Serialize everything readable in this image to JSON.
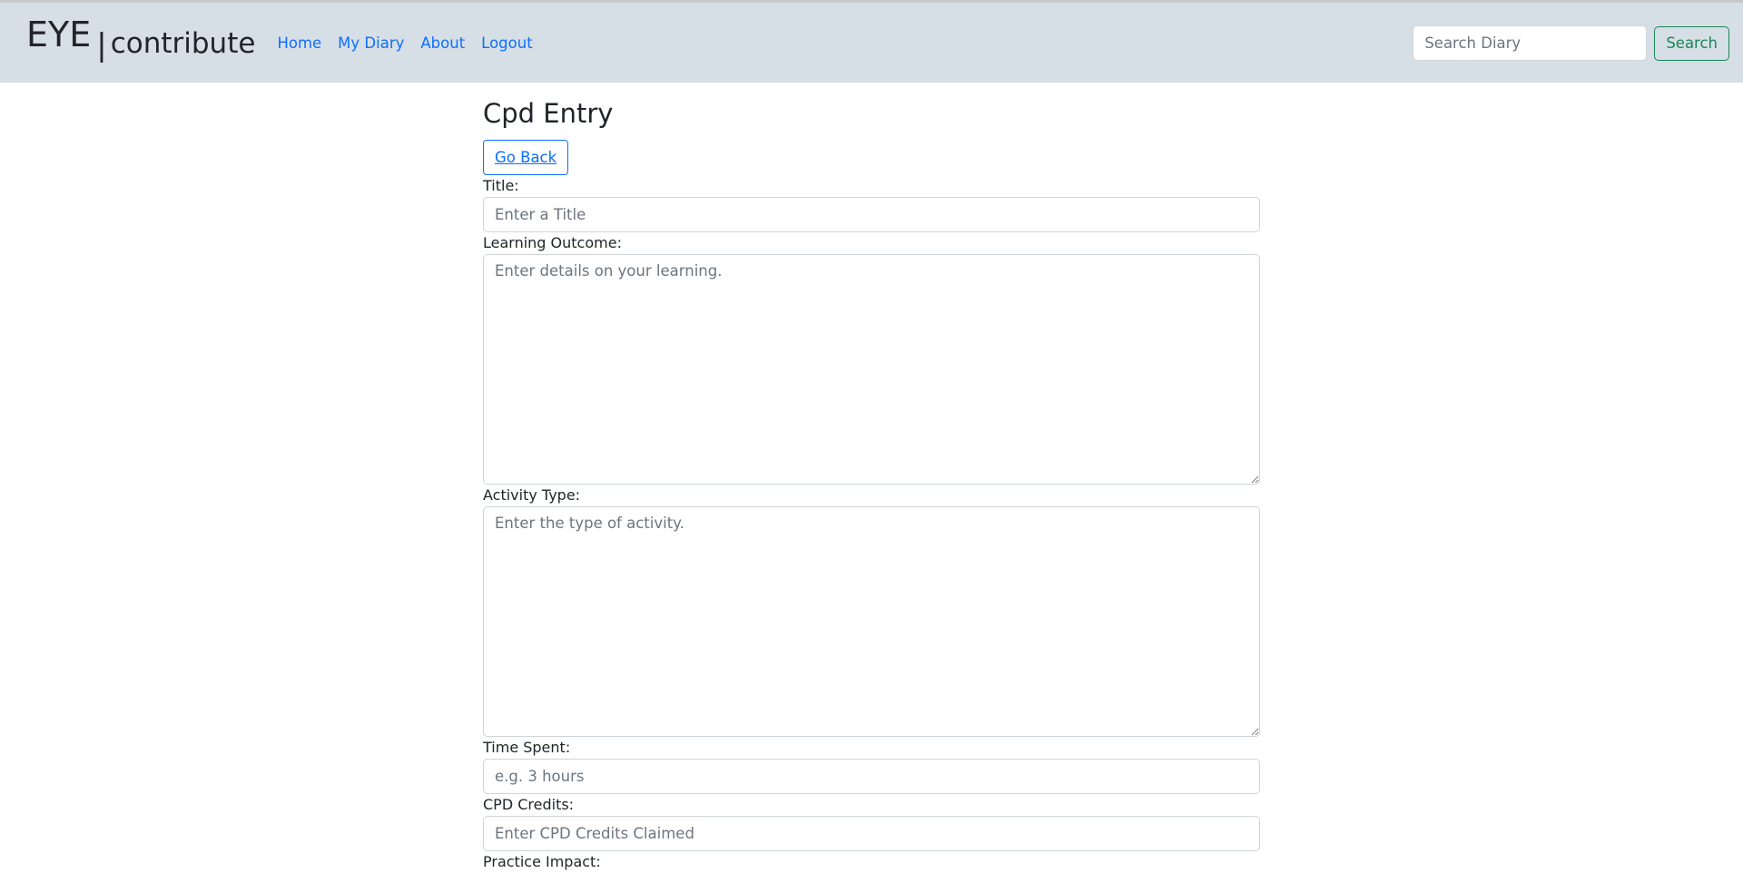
{
  "brand": {
    "eye": "EYE",
    "pipe": "|",
    "contribute": "contribute"
  },
  "nav": {
    "items": [
      {
        "label": "Home"
      },
      {
        "label": "My Diary"
      },
      {
        "label": "About"
      },
      {
        "label": "Logout"
      }
    ]
  },
  "search": {
    "placeholder": "Search Diary",
    "button_label": "Search"
  },
  "page": {
    "title": "Cpd Entry",
    "back_label": "Go Back"
  },
  "form": {
    "title_label": "Title:",
    "title_placeholder": "Enter a Title",
    "outcome_label": "Learning Outcome:",
    "outcome_placeholder": "Enter details on your learning.",
    "activity_label": "Activity Type:",
    "activity_placeholder": "Enter the type of activity.",
    "time_label": "Time Spent:",
    "time_placeholder": "e.g. 3 hours",
    "credits_label": "CPD Credits:",
    "credits_placeholder": "Enter CPD Credits Claimed",
    "impact_label": "Practice Impact:"
  },
  "colors": {
    "navbar_bg": "#d7dfe6",
    "link": "#0d6efd",
    "success": "#198754"
  }
}
